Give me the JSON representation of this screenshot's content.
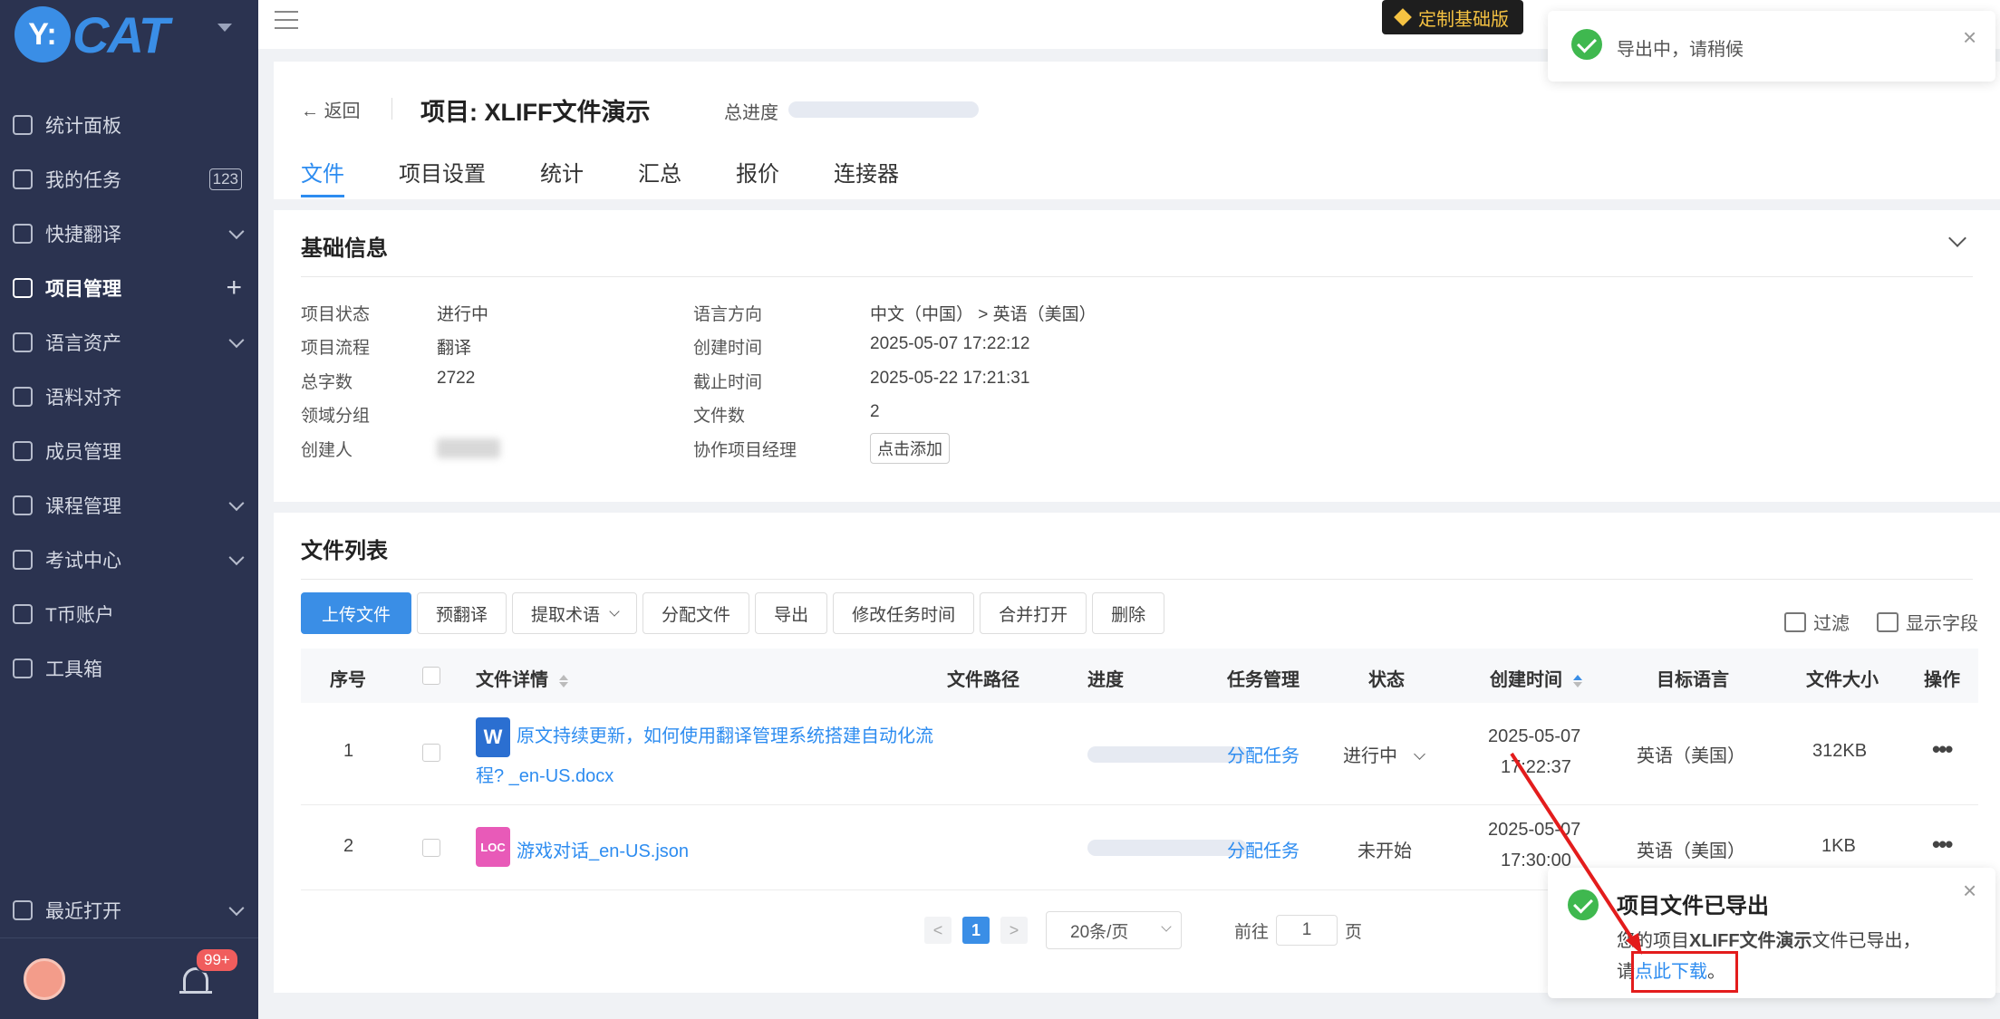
{
  "brand": {
    "logo_mark": "Y:",
    "logo_text": "CAT"
  },
  "sidebar": {
    "items": [
      {
        "label": "统计面板",
        "icon": "dashboard-icon",
        "right": ""
      },
      {
        "label": "我的任务",
        "icon": "task-icon",
        "right": "123"
      },
      {
        "label": "快捷翻译",
        "icon": "translate-icon",
        "right": "chevron"
      },
      {
        "label": "项目管理",
        "icon": "project-icon",
        "right": "plus"
      },
      {
        "label": "语言资产",
        "icon": "database-icon",
        "right": "chevron"
      },
      {
        "label": "语料对齐",
        "icon": "align-icon",
        "right": ""
      },
      {
        "label": "成员管理",
        "icon": "members-icon",
        "right": ""
      },
      {
        "label": "课程管理",
        "icon": "course-icon",
        "right": "chevron"
      },
      {
        "label": "考试中心",
        "icon": "exam-icon",
        "right": "chevron"
      },
      {
        "label": "T币账户",
        "icon": "wallet-icon",
        "right": ""
      },
      {
        "label": "工具箱",
        "icon": "toolbox-icon",
        "right": ""
      }
    ],
    "recent_label": "最近打开",
    "task_count": "123",
    "plus_glyph": "+",
    "notification_badge": "99+"
  },
  "topbar": {
    "vip_label": "定制基础版"
  },
  "project": {
    "back_label": "返回",
    "title": "项目: XLIFF文件演示",
    "progress_label": "总进度",
    "tabs": [
      "文件",
      "项目设置",
      "统计",
      "汇总",
      "报价",
      "连接器"
    ]
  },
  "basic_info": {
    "title": "基础信息",
    "left": [
      {
        "label": "项目状态",
        "value": "进行中"
      },
      {
        "label": "项目流程",
        "value": "翻译"
      },
      {
        "label": "总字数",
        "value": "2722"
      },
      {
        "label": "领域分组",
        "value": ""
      },
      {
        "label": "创建人",
        "value": ""
      }
    ],
    "right": [
      {
        "label": "语言方向",
        "value": "中文（中国）  >  英语（美国）"
      },
      {
        "label": "创建时间",
        "value": "2025-05-07 17:22:12"
      },
      {
        "label": "截止时间",
        "value": "2025-05-22 17:21:31"
      },
      {
        "label": "文件数",
        "value": "2"
      },
      {
        "label": "协作项目经理",
        "value": ""
      }
    ],
    "add_manager_label": "点击添加"
  },
  "file_list": {
    "title": "文件列表",
    "toolbar": [
      "上传文件",
      "预翻译",
      "提取术语",
      "分配文件",
      "导出",
      "修改任务时间",
      "合并打开",
      "删除"
    ],
    "filter_label": "过滤",
    "fields_label": "显示字段",
    "columns": [
      "序号",
      "文件详情",
      "文件路径",
      "进度",
      "任务管理",
      "状态",
      "创建时间",
      "目标语言",
      "文件大小",
      "操作"
    ],
    "rows": [
      {
        "index": "1",
        "file_type": "W",
        "file_color": "#2b6fd1",
        "name_line1": "原文持续更新，如何使用翻译管理系统搭建自动化流",
        "name_line2": "程? _en-US.docx",
        "task": "分配任务",
        "status": "进行中",
        "created_date": "2025-05-07",
        "created_time": "17:22:37",
        "target": "英语（美国）",
        "size": "312KB",
        "actions": "•••"
      },
      {
        "index": "2",
        "file_type": "LOC",
        "file_color": "#e85ab8",
        "name_line1": "游戏对话_en-US.json",
        "name_line2": "",
        "task": "分配任务",
        "status": "未开始",
        "created_date": "2025-05-07",
        "created_time": "17:30:00",
        "target": "英语（美国）",
        "size": "1KB",
        "actions": "•••"
      }
    ],
    "pagination": {
      "prev": "<",
      "current": "1",
      "next": ">",
      "page_size": "20条/页",
      "goto_label": "前往",
      "goto_value": "1",
      "page_suffix": "页"
    }
  },
  "toasts": {
    "exporting": "导出中，请稍候",
    "exported_title": "项目文件已导出",
    "exported_body_pre": "您的项目",
    "exported_body_project": "XLIFF文件演示",
    "exported_body_mid": "文件已导出，",
    "exported_body_line2_pre": "请",
    "exported_link": "点此下载",
    "exported_body_end": "。",
    "close_glyph": "×"
  },
  "colors": {
    "accent": "#3a8ee6",
    "sidebar_bg": "#2b3350",
    "success": "#3fb84f",
    "annotation_red": "#e31c1c"
  }
}
